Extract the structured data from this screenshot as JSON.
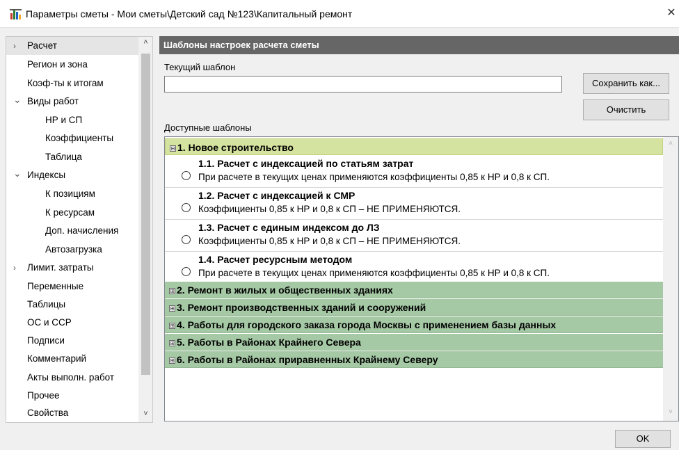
{
  "window": {
    "title": "Параметры сметы - Мои сметы\\Детский сад №123\\Капитальный ремонт",
    "close_symbol": "✕"
  },
  "sidebar": {
    "items": [
      {
        "label": "Расчет",
        "arrow": "›",
        "selected": true
      },
      {
        "label": "Регион и зона"
      },
      {
        "label": "Коэф-ты к итогам"
      },
      {
        "label": "Виды работ",
        "arrow": "⌄"
      },
      {
        "label": "НР и СП"
      },
      {
        "label": "Коэффициенты"
      },
      {
        "label": "Таблица"
      },
      {
        "label": "Индексы",
        "arrow": "⌄"
      },
      {
        "label": "К позициям"
      },
      {
        "label": "К ресурсам"
      },
      {
        "label": "Доп. начисления"
      },
      {
        "label": "Автозагрузка"
      },
      {
        "label": "Лимит. затраты",
        "arrow": "›"
      },
      {
        "label": "Переменные"
      },
      {
        "label": "Таблицы"
      },
      {
        "label": "ОС и ССР"
      },
      {
        "label": "Подписи"
      },
      {
        "label": "Комментарий"
      },
      {
        "label": "Акты выполн. работ"
      },
      {
        "label": "Прочее"
      },
      {
        "label": "Свойства"
      }
    ],
    "scroll_up": "˄",
    "scroll_down": "˅"
  },
  "panel": {
    "header": "Шаблоны настроек расчета сметы",
    "current_template_label": "Текущий шаблон",
    "current_template_value": "",
    "save_as_label": "Сохранить как...",
    "clear_label": "Очистить",
    "available_label": "Доступные шаблоны"
  },
  "tree": {
    "groups": [
      {
        "label": "1. Новое строительство",
        "expanded": true,
        "toggle": "⊟"
      },
      {
        "label": "2. Ремонт в жилых и общественных зданиях",
        "expanded": false,
        "toggle": "⊞"
      },
      {
        "label": "3. Ремонт производственных зданий и сооружений",
        "expanded": false,
        "toggle": "⊞"
      },
      {
        "label": "4. Работы для городского заказа города Москвы с применением базы данных",
        "expanded": false,
        "toggle": "⊞"
      },
      {
        "label": "5. Работы в Районах Крайнего Севера",
        "expanded": false,
        "toggle": "⊞"
      },
      {
        "label": "6. Работы в Районах приравненных Крайнему Северу",
        "expanded": false,
        "toggle": "⊞"
      }
    ],
    "options": [
      {
        "title": "1.1. Расчет с индексацией по статьям затрат",
        "desc": "При расчете в текущих ценах применяются коэффициенты 0,85 к НР и 0,8 к СП."
      },
      {
        "title": "1.2. Расчет с индексацией к СМР",
        "desc": "Коэффициенты 0,85 к НР и 0,8 к СП – НЕ ПРИМЕНЯЮТСЯ."
      },
      {
        "title": "1.3. Расчет с единым индексом до ЛЗ",
        "desc": "Коэффициенты 0,85 к НР и 0,8 к СП – НЕ ПРИМЕНЯЮТСЯ."
      },
      {
        "title": "1.4. Расчет ресурсным методом",
        "desc": "При расчете в текущих ценах применяются коэффициенты 0,85 к НР и 0,8 к СП."
      }
    ],
    "scroll_up": "˄",
    "scroll_down": "˅"
  },
  "footer": {
    "ok_label": "OK"
  },
  "colors": {
    "header_bg": "#666666",
    "group_open_bg": "#d4e3a0",
    "group_closed_bg": "#a5c8a5"
  }
}
